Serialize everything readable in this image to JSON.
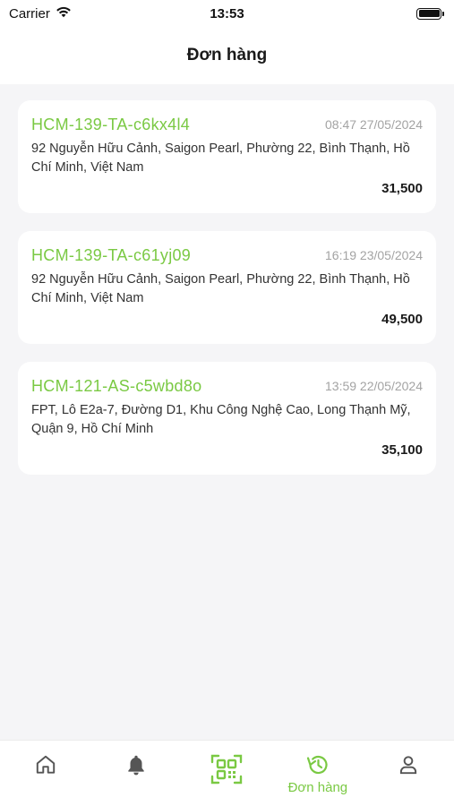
{
  "status_bar": {
    "carrier": "Carrier",
    "time": "13:53"
  },
  "header": {
    "title": "Đơn hàng"
  },
  "colors": {
    "accent": "#7ac943",
    "muted": "#a3a3a3",
    "background": "#f5f5f7"
  },
  "orders": [
    {
      "code": "HCM-139-TA-c6kx4l4",
      "time": "08:47 27/05/2024",
      "address": "92 Nguyễn Hữu Cảnh, Saigon Pearl, Phường 22, Bình Thạnh, Hồ Chí Minh, Việt Nam",
      "amount": "31,500"
    },
    {
      "code": "HCM-139-TA-c61yj09",
      "time": "16:19 23/05/2024",
      "address": "92 Nguyễn Hữu Cảnh, Saigon Pearl, Phường 22, Bình Thạnh, Hồ Chí Minh, Việt Nam",
      "amount": "49,500"
    },
    {
      "code": "HCM-121-AS-c5wbd8o",
      "time": "13:59 22/05/2024",
      "address": "FPT, Lô E2a-7, Đường D1, Khu Công Nghệ Cao, Long Thạnh Mỹ, Quận 9, Hồ Chí Minh",
      "amount": "35,100"
    }
  ],
  "tab_bar": {
    "tabs": [
      {
        "icon": "home-icon",
        "label": ""
      },
      {
        "icon": "bell-icon",
        "label": ""
      },
      {
        "icon": "qr-scan-icon",
        "label": ""
      },
      {
        "icon": "history-icon",
        "label": "Đơn hàng",
        "active": true
      },
      {
        "icon": "user-icon",
        "label": ""
      }
    ]
  }
}
